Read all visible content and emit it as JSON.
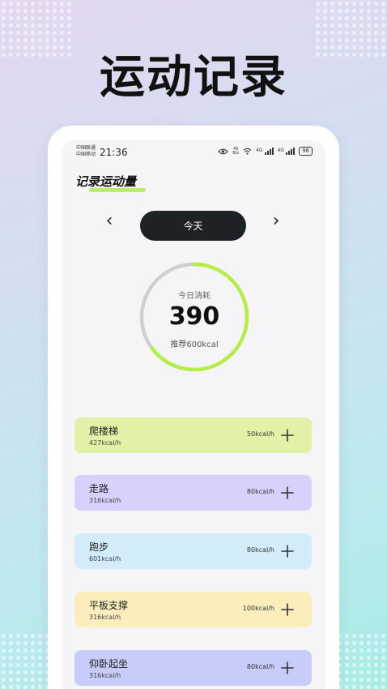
{
  "headline": "运动记录",
  "status_bar": {
    "carrier_1": "中国联通",
    "carrier_2": "中国移动",
    "time": "21:36",
    "net_speed_top": "45",
    "net_speed_bottom": "B/s",
    "signal_1": "4G",
    "signal_2": "4G",
    "battery": "96"
  },
  "page": {
    "title": "记录运动量"
  },
  "date_nav": {
    "prev": "‹",
    "current": "今天",
    "next": "›"
  },
  "summary": {
    "label": "今日消耗",
    "value": "390",
    "recommend": "推荐600kcal",
    "progress": 0.65,
    "colors": {
      "progress": "#b6ee48",
      "track": "#cfcfcf"
    }
  },
  "activities": [
    {
      "name": "爬楼梯",
      "sub": "427kcal/h",
      "rate": "50kcal/h",
      "color": "#e1f2a6"
    },
    {
      "name": "走路",
      "sub": "316kcal/h",
      "rate": "80kcal/h",
      "color": "#d9d1fb"
    },
    {
      "name": "跑步",
      "sub": "601kcal/h",
      "rate": "80kcal/h",
      "color": "#d2ecfa"
    },
    {
      "name": "平板支撑",
      "sub": "316kcal/h",
      "rate": "100kcal/h",
      "color": "#fbeebc"
    },
    {
      "name": "仰卧起坐",
      "sub": "316kcal/h",
      "rate": "80kcal/h",
      "color": "#c7ccfa"
    }
  ],
  "icons": {
    "add": "plus-icon",
    "status": [
      "eye-icon",
      "wifi-icon",
      "signal-icon",
      "battery-icon"
    ]
  }
}
